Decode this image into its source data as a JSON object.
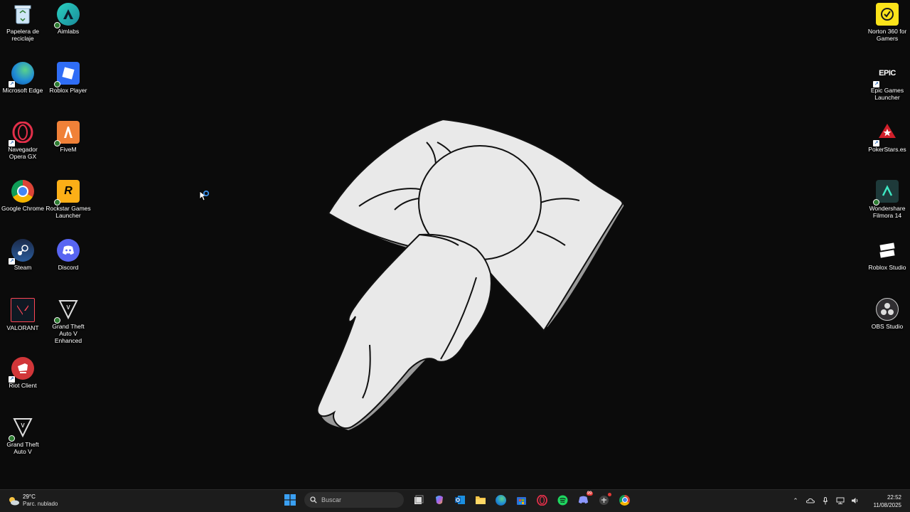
{
  "desktop": {
    "left_column": [
      {
        "label": "Papelera de reciclaje"
      },
      {
        "label": "Microsoft Edge"
      },
      {
        "label": "Navegador Opera GX"
      },
      {
        "label": "Google Chrome"
      },
      {
        "label": "Steam"
      },
      {
        "label": "VALORANT"
      },
      {
        "label": "Riot Client"
      },
      {
        "label": "Grand Theft Auto V"
      }
    ],
    "second_column": [
      {
        "label": "Aimlabs"
      },
      {
        "label": "Roblox Player"
      },
      {
        "label": "FiveM"
      },
      {
        "label": "Rockstar Games Launcher"
      },
      {
        "label": "Discord"
      },
      {
        "label": "Grand Theft Auto V Enhanced"
      }
    ],
    "right_column": [
      {
        "label": "Norton 360 for Gamers"
      },
      {
        "label": "Epic Games Launcher"
      },
      {
        "label": "PokerStars.es"
      },
      {
        "label": "Wondershare Filmora 14"
      },
      {
        "label": "Roblox Studio"
      },
      {
        "label": "OBS Studio"
      }
    ],
    "icon_glyphs": {
      "epic": "EPIC",
      "rockstar": "R"
    }
  },
  "taskbar": {
    "weather": {
      "temp": "29°C",
      "desc": "Parc. nublado"
    },
    "search": {
      "placeholder": "Buscar"
    },
    "clock": {
      "time": "22:52",
      "date": "11/08/2025"
    },
    "discord_badge": "99"
  },
  "colors": {
    "taskbar": "#1c1c1c",
    "desktop": "#0b0b0b",
    "accent": "#0078d4"
  }
}
